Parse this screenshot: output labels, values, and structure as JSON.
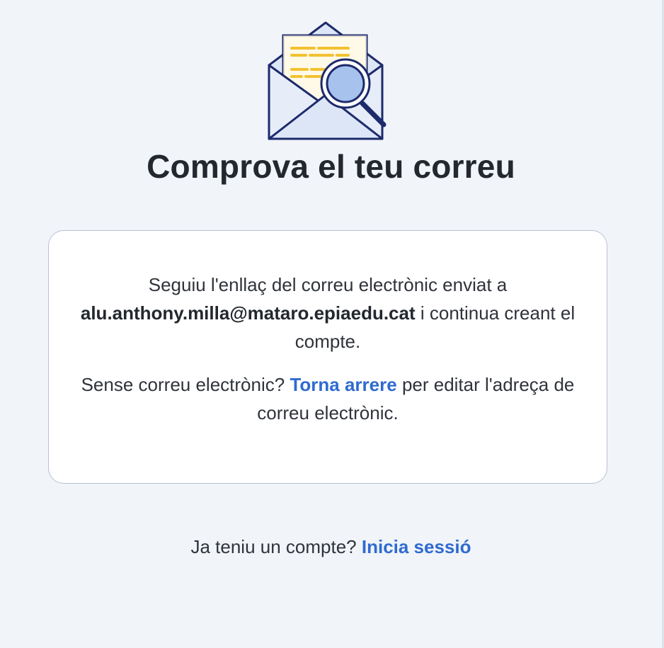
{
  "title": "Comprova el teu correu",
  "icon": "envelope-search-icon",
  "message": {
    "line1": "Seguiu l'enllaç del correu electrònic enviat a",
    "email": "alu.anthony.milla@mataro.epiaedu.cat",
    "line2": "i continua creant el compte."
  },
  "no_email": {
    "prefix": "Sense correu electrònic?",
    "link": "Torna arrere",
    "suffix": "per editar l'adreça de correu electrònic."
  },
  "footer": {
    "prefix": "Ja teniu un compte?",
    "link": "Inicia sessió"
  },
  "colors": {
    "link": "#2f6bcf",
    "background": "#f1f4f8",
    "card_border": "#b9c1d6",
    "icon_outline": "#1d2a6b",
    "icon_accent": "#f2c230"
  }
}
